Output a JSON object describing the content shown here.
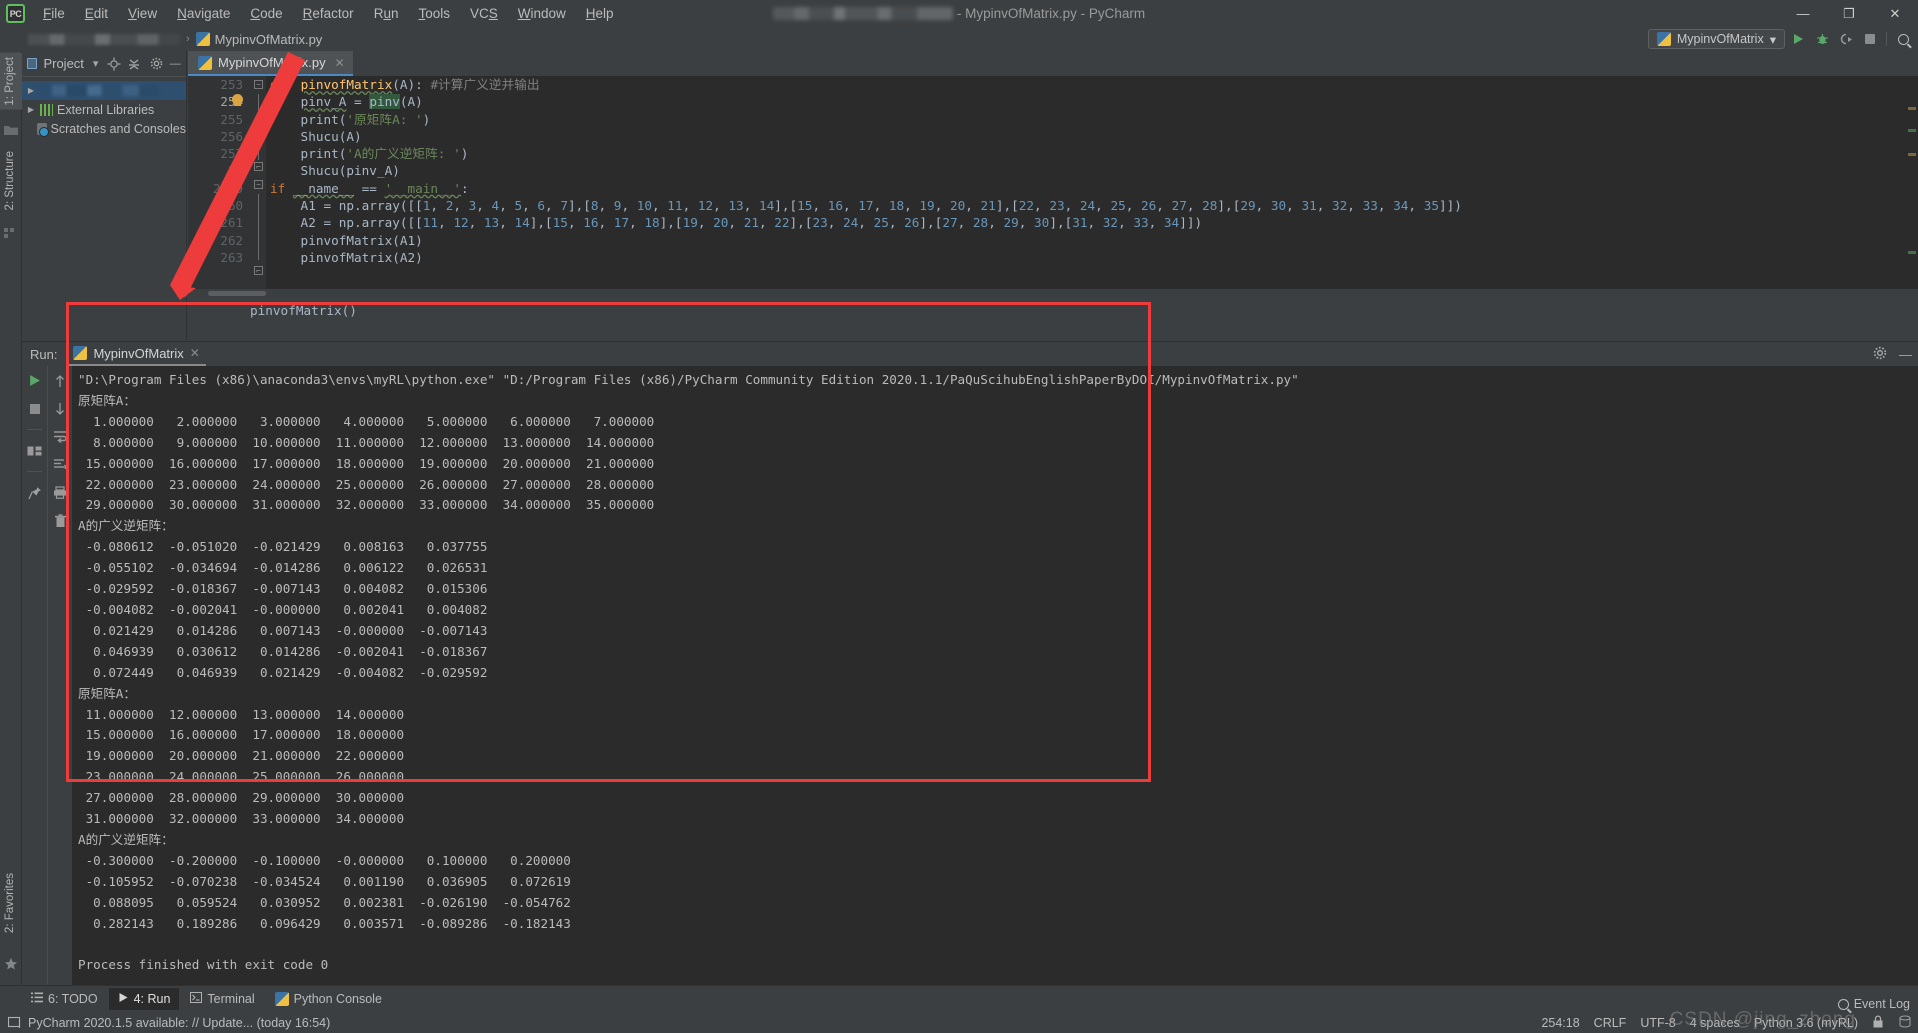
{
  "titlebar": {
    "logo": "PC",
    "menus": [
      "File",
      "Edit",
      "View",
      "Navigate",
      "Code",
      "Refactor",
      "Run",
      "Tools",
      "VCS",
      "Window",
      "Help"
    ],
    "title_suffix": "- MypinvOfMatrix.py - PyCharm",
    "minimize": "—",
    "maximize": "❐",
    "close": "✕"
  },
  "navbar": {
    "file_crumb": "MypinvOfMatrix.py",
    "separator": "›",
    "run_config": "MypinvOfMatrix",
    "dropdown_caret": "▾",
    "icons": [
      "run-icon",
      "debug-icon",
      "coverage-icon",
      "stop-icon",
      "search-icon"
    ]
  },
  "left_strip": {
    "project_tab": "1: Project",
    "structure_tab": "2: Structure",
    "favorites_tab": "2: Favorites"
  },
  "project_panel": {
    "header": "Project",
    "header_caret": "▾",
    "tree": [
      {
        "label": "",
        "blurred": true,
        "arrow": "▶",
        "icon": "folder-icon"
      },
      {
        "label": "External Libraries",
        "blurred": false,
        "arrow": "▶",
        "icon": "library-icon"
      },
      {
        "label": "Scratches and Consoles",
        "blurred": false,
        "arrow": "",
        "icon": "scratches-icon"
      }
    ]
  },
  "editor": {
    "tab_label": "MypinvOfMatrix.py",
    "tab_close": "✕",
    "line_numbers": [
      "253",
      "254",
      "255",
      "256",
      "257",
      "25",
      "2 9",
      "60",
      "261",
      "262",
      "263"
    ],
    "below_text": "pinvofMatrix()",
    "code_lines": [
      {
        "no": "253",
        "segments": [
          {
            "t": "def ",
            "c": "kw"
          },
          {
            "t": "pinvofMatrix",
            "c": "fn ulw"
          },
          {
            "t": "(A): ",
            "c": "var"
          },
          {
            "t": "#计算广义逆并输出",
            "c": "com"
          }
        ]
      },
      {
        "no": "254",
        "segments": [
          {
            "t": "    ",
            "c": "var"
          },
          {
            "t": "pinv_A",
            "c": "var ulw"
          },
          {
            "t": " = ",
            "c": "var"
          },
          {
            "t": "pinv",
            "c": "hl"
          },
          {
            "t": "(A)",
            "c": "var"
          }
        ]
      },
      {
        "no": "255",
        "segments": [
          {
            "t": "    print(",
            "c": "var"
          },
          {
            "t": "'原矩阵A: '",
            "c": "str"
          },
          {
            "t": ")",
            "c": "var"
          }
        ]
      },
      {
        "no": "256",
        "segments": [
          {
            "t": "    Shucu(A)",
            "c": "var"
          }
        ]
      },
      {
        "no": "257",
        "segments": [
          {
            "t": "    print(",
            "c": "var"
          },
          {
            "t": "'A的广义逆矩阵: '",
            "c": "str"
          },
          {
            "t": ")",
            "c": "var"
          }
        ]
      },
      {
        "no": "258",
        "segments": [
          {
            "t": "    Shucu(pinv_A)",
            "c": "var"
          }
        ]
      },
      {
        "no": "259",
        "segments": [
          {
            "t": "if ",
            "c": "kw"
          },
          {
            "t": "__name__",
            "c": "var ulw"
          },
          {
            "t": " == ",
            "c": "var"
          },
          {
            "t": "'__main__'",
            "c": "str ulw"
          },
          {
            "t": ":",
            "c": "var"
          }
        ]
      },
      {
        "no": "260",
        "segments": [
          {
            "t": "    A1 = np.array([[",
            "c": "var"
          },
          {
            "t": "1",
            "c": "num"
          },
          {
            "t": ", ",
            "c": "var"
          },
          {
            "t": "2",
            "c": "num"
          },
          {
            "t": ", ",
            "c": "var"
          },
          {
            "t": "3",
            "c": "num"
          },
          {
            "t": ", ",
            "c": "var"
          },
          {
            "t": "4",
            "c": "num"
          },
          {
            "t": ", ",
            "c": "var"
          },
          {
            "t": "5",
            "c": "num"
          },
          {
            "t": ", ",
            "c": "var"
          },
          {
            "t": "6",
            "c": "num"
          },
          {
            "t": ", ",
            "c": "var"
          },
          {
            "t": "7",
            "c": "num"
          },
          {
            "t": "],",
            "c": "var"
          },
          {
            "t": "[",
            "c": "var"
          },
          {
            "t": "8",
            "c": "num"
          },
          {
            "t": ", ",
            "c": "var"
          },
          {
            "t": "9",
            "c": "num"
          },
          {
            "t": ", ",
            "c": "var"
          },
          {
            "t": "10",
            "c": "num"
          },
          {
            "t": ", ",
            "c": "var"
          },
          {
            "t": "11",
            "c": "num"
          },
          {
            "t": ", ",
            "c": "var"
          },
          {
            "t": "12",
            "c": "num"
          },
          {
            "t": ", ",
            "c": "var"
          },
          {
            "t": "13",
            "c": "num"
          },
          {
            "t": ", ",
            "c": "var"
          },
          {
            "t": "14",
            "c": "num"
          },
          {
            "t": "],",
            "c": "var"
          },
          {
            "t": "[",
            "c": "var"
          },
          {
            "t": "15",
            "c": "num"
          },
          {
            "t": ", ",
            "c": "var"
          },
          {
            "t": "16",
            "c": "num"
          },
          {
            "t": ", ",
            "c": "var"
          },
          {
            "t": "17",
            "c": "num"
          },
          {
            "t": ", ",
            "c": "var"
          },
          {
            "t": "18",
            "c": "num"
          },
          {
            "t": ", ",
            "c": "var"
          },
          {
            "t": "19",
            "c": "num"
          },
          {
            "t": ", ",
            "c": "var"
          },
          {
            "t": "20",
            "c": "num"
          },
          {
            "t": ", ",
            "c": "var"
          },
          {
            "t": "21",
            "c": "num"
          },
          {
            "t": "],",
            "c": "var"
          },
          {
            "t": "[",
            "c": "var"
          },
          {
            "t": "22",
            "c": "num"
          },
          {
            "t": ", ",
            "c": "var"
          },
          {
            "t": "23",
            "c": "num"
          },
          {
            "t": ", ",
            "c": "var"
          },
          {
            "t": "24",
            "c": "num"
          },
          {
            "t": ", ",
            "c": "var"
          },
          {
            "t": "25",
            "c": "num"
          },
          {
            "t": ", ",
            "c": "var"
          },
          {
            "t": "26",
            "c": "num"
          },
          {
            "t": ", ",
            "c": "var"
          },
          {
            "t": "27",
            "c": "num"
          },
          {
            "t": ", ",
            "c": "var"
          },
          {
            "t": "28",
            "c": "num"
          },
          {
            "t": "],",
            "c": "var"
          },
          {
            "t": "[",
            "c": "var"
          },
          {
            "t": "29",
            "c": "num"
          },
          {
            "t": ", ",
            "c": "var"
          },
          {
            "t": "30",
            "c": "num"
          },
          {
            "t": ", ",
            "c": "var"
          },
          {
            "t": "31",
            "c": "num"
          },
          {
            "t": ", ",
            "c": "var"
          },
          {
            "t": "32",
            "c": "num"
          },
          {
            "t": ", ",
            "c": "var"
          },
          {
            "t": "33",
            "c": "num"
          },
          {
            "t": ", ",
            "c": "var"
          },
          {
            "t": "34",
            "c": "num"
          },
          {
            "t": ", ",
            "c": "var"
          },
          {
            "t": "35",
            "c": "num"
          },
          {
            "t": "]])",
            "c": "var"
          }
        ]
      },
      {
        "no": "261",
        "segments": [
          {
            "t": "    A2 = np.array([[",
            "c": "var"
          },
          {
            "t": "11",
            "c": "num"
          },
          {
            "t": ", ",
            "c": "var"
          },
          {
            "t": "12",
            "c": "num"
          },
          {
            "t": ", ",
            "c": "var"
          },
          {
            "t": "13",
            "c": "num"
          },
          {
            "t": ", ",
            "c": "var"
          },
          {
            "t": "14",
            "c": "num"
          },
          {
            "t": "],",
            "c": "var"
          },
          {
            "t": "[",
            "c": "var"
          },
          {
            "t": "15",
            "c": "num"
          },
          {
            "t": ", ",
            "c": "var"
          },
          {
            "t": "16",
            "c": "num"
          },
          {
            "t": ", ",
            "c": "var"
          },
          {
            "t": "17",
            "c": "num"
          },
          {
            "t": ", ",
            "c": "var"
          },
          {
            "t": "18",
            "c": "num"
          },
          {
            "t": "],",
            "c": "var"
          },
          {
            "t": "[",
            "c": "var"
          },
          {
            "t": "19",
            "c": "num"
          },
          {
            "t": ", ",
            "c": "var"
          },
          {
            "t": "20",
            "c": "num"
          },
          {
            "t": ", ",
            "c": "var"
          },
          {
            "t": "21",
            "c": "num"
          },
          {
            "t": ", ",
            "c": "var"
          },
          {
            "t": "22",
            "c": "num"
          },
          {
            "t": "],",
            "c": "var"
          },
          {
            "t": "[",
            "c": "var"
          },
          {
            "t": "23",
            "c": "num"
          },
          {
            "t": ", ",
            "c": "var"
          },
          {
            "t": "24",
            "c": "num"
          },
          {
            "t": ", ",
            "c": "var"
          },
          {
            "t": "25",
            "c": "num"
          },
          {
            "t": ", ",
            "c": "var"
          },
          {
            "t": "26",
            "c": "num"
          },
          {
            "t": "],",
            "c": "var"
          },
          {
            "t": "[",
            "c": "var"
          },
          {
            "t": "27",
            "c": "num"
          },
          {
            "t": ", ",
            "c": "var"
          },
          {
            "t": "28",
            "c": "num"
          },
          {
            "t": ", ",
            "c": "var"
          },
          {
            "t": "29",
            "c": "num"
          },
          {
            "t": ", ",
            "c": "var"
          },
          {
            "t": "30",
            "c": "num"
          },
          {
            "t": "],",
            "c": "var"
          },
          {
            "t": "[",
            "c": "var"
          },
          {
            "t": "31",
            "c": "num"
          },
          {
            "t": ", ",
            "c": "var"
          },
          {
            "t": "32",
            "c": "num"
          },
          {
            "t": ", ",
            "c": "var"
          },
          {
            "t": "33",
            "c": "num"
          },
          {
            "t": ", ",
            "c": "var"
          },
          {
            "t": "34",
            "c": "num"
          },
          {
            "t": "]])",
            "c": "var"
          }
        ]
      },
      {
        "no": "262",
        "segments": [
          {
            "t": "    pinvofMatrix(A1)",
            "c": "var"
          }
        ]
      },
      {
        "no": "263",
        "segments": [
          {
            "t": "    pinvofMatrix(A2)",
            "c": "var"
          }
        ]
      }
    ]
  },
  "run_panel": {
    "label": "Run:",
    "tab_name": "MypinvOfMatrix",
    "tab_close": "✕",
    "settings_icon": "gear-icon",
    "hide_icon": "minimize-icon",
    "tool_icons_a": [
      "rerun-icon",
      "stop-icon",
      "layout-icon",
      "pin-icon"
    ],
    "tool_icons_b": [
      "up-icon",
      "down-icon",
      "soft-wrap-icon",
      "scroll-to-end-icon",
      "print-icon",
      "trash-icon"
    ],
    "console": [
      "\"D:\\Program Files (x86)\\anaconda3\\envs\\myRL\\python.exe\" \"D:/Program Files (x86)/PyCharm Community Edition 2020.1.1/PaQuScihubEnglishPaperByDOI/MypinvOfMatrix.py\"",
      "原矩阵A：",
      "  1.000000   2.000000   3.000000   4.000000   5.000000   6.000000   7.000000",
      "  8.000000   9.000000  10.000000  11.000000  12.000000  13.000000  14.000000",
      " 15.000000  16.000000  17.000000  18.000000  19.000000  20.000000  21.000000",
      " 22.000000  23.000000  24.000000  25.000000  26.000000  27.000000  28.000000",
      " 29.000000  30.000000  31.000000  32.000000  33.000000  34.000000  35.000000",
      "A的广义逆矩阵：",
      " -0.080612  -0.051020  -0.021429   0.008163   0.037755",
      " -0.055102  -0.034694  -0.014286   0.006122   0.026531",
      " -0.029592  -0.018367  -0.007143   0.004082   0.015306",
      " -0.004082  -0.002041  -0.000000   0.002041   0.004082",
      "  0.021429   0.014286   0.007143  -0.000000  -0.007143",
      "  0.046939   0.030612   0.014286  -0.002041  -0.018367",
      "  0.072449   0.046939   0.021429  -0.004082  -0.029592",
      "原矩阵A：",
      " 11.000000  12.000000  13.000000  14.000000",
      " 15.000000  16.000000  17.000000  18.000000",
      " 19.000000  20.000000  21.000000  22.000000",
      " 23.000000  24.000000  25.000000  26.000000",
      " 27.000000  28.000000  29.000000  30.000000",
      " 31.000000  32.000000  33.000000  34.000000",
      "A的广义逆矩阵：",
      " -0.300000  -0.200000  -0.100000  -0.000000   0.100000   0.200000",
      " -0.105952  -0.070238  -0.034524   0.001190   0.036905   0.072619",
      "  0.088095   0.059524   0.030952   0.002381  -0.026190  -0.054762",
      "  0.282143   0.189286   0.096429   0.003571  -0.089286  -0.182143",
      "",
      "Process finished with exit code 0"
    ]
  },
  "toolwindow_bar": {
    "items": [
      {
        "label": "6: TODO",
        "underline": "6",
        "icon": "todo-icon",
        "active": false
      },
      {
        "label": "4: Run",
        "underline": "4",
        "icon": "run-icon",
        "active": true
      },
      {
        "label": "Terminal",
        "underline": "",
        "icon": "terminal-icon",
        "active": false
      },
      {
        "label": "Python Console",
        "underline": "",
        "icon": "python-icon",
        "active": false
      }
    ]
  },
  "status_bar": {
    "message": "PyCharm 2020.1.5 available: // Update... (today 16:54)",
    "message_icon": "notification-icon",
    "caret_position": "254:18",
    "line_separator": "CRLF",
    "encoding": "UTF-8",
    "indent": "4 spaces",
    "interpreter": "Python 3.6 (myRL)",
    "event_log": "Event Log",
    "watermark": "CSDN @jing_zhong"
  },
  "colors": {
    "accent": "#4a88c7",
    "annotation_red": "#ee3b3b",
    "bg_panel": "#3c3f41",
    "bg_editor": "#2b2b2b",
    "green": "#59a869"
  }
}
